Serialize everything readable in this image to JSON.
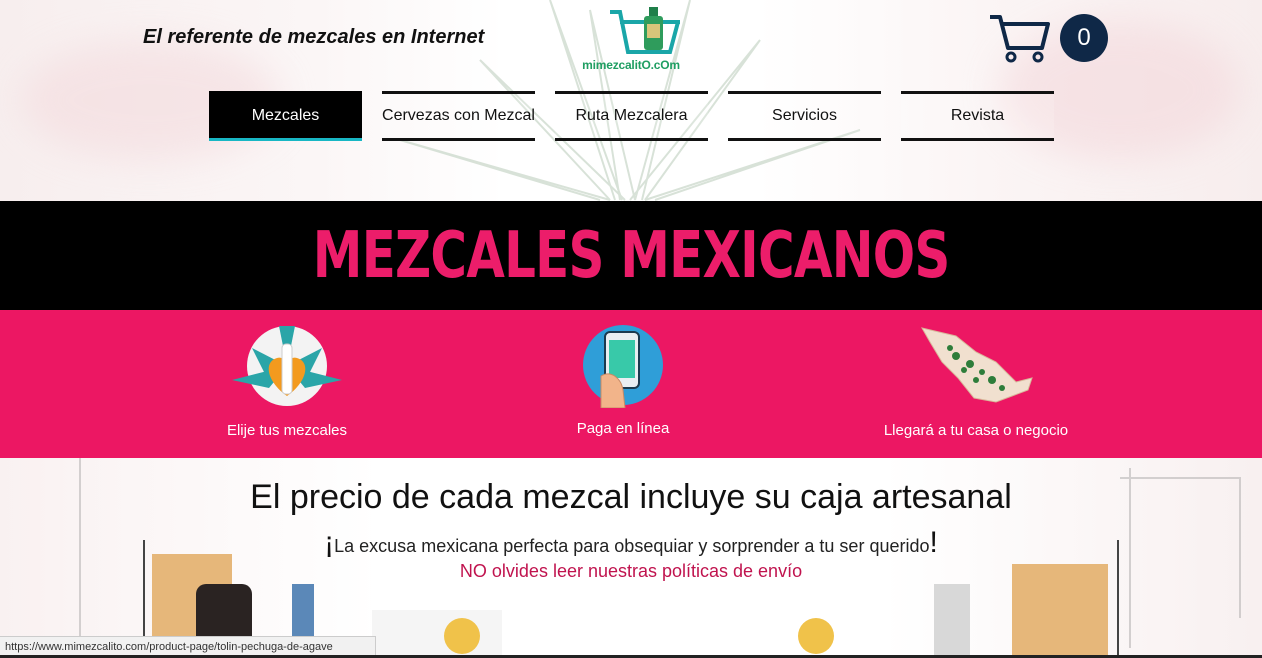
{
  "header": {
    "tagline": "El referente de mezcales en Internet",
    "logo_text": "mimezcalitO.cOm",
    "cart_count": "0"
  },
  "nav": {
    "items": [
      {
        "label": "Mezcales",
        "active": true
      },
      {
        "label": "Cervezas con Mezcal"
      },
      {
        "label": "Ruta Mezcalera"
      },
      {
        "label": "Servicios"
      },
      {
        "label": "Revista"
      }
    ]
  },
  "banner": {
    "title": "MEZCALES MEXICANOS"
  },
  "features": [
    {
      "label": "Elije tus mezcales",
      "icon": "agave-bottle-icon"
    },
    {
      "label": "Paga en línea",
      "icon": "smartphone-hand-icon"
    },
    {
      "label": "Llegará a tu casa o negocio",
      "icon": "mexico-map-icon"
    }
  ],
  "promo": {
    "headline": "El precio de cada mezcal incluye su caja artesanal",
    "subline_open": "¡",
    "subline": "La excusa mexicana perfecta para obsequiar y sorprender a tu ser querido",
    "subline_close": "!",
    "warning": "NO olvides leer nuestras políticas de envío"
  },
  "status_url": "https://www.mimezcalito.com/product-page/tolin-pechuga-de-agave",
  "colors": {
    "pink": "#ec1763",
    "banner_text": "#ec1d6a",
    "nav_active_underline": "#18b7c4",
    "cart_badge": "#0f2847",
    "warning_text": "#c0134e"
  }
}
